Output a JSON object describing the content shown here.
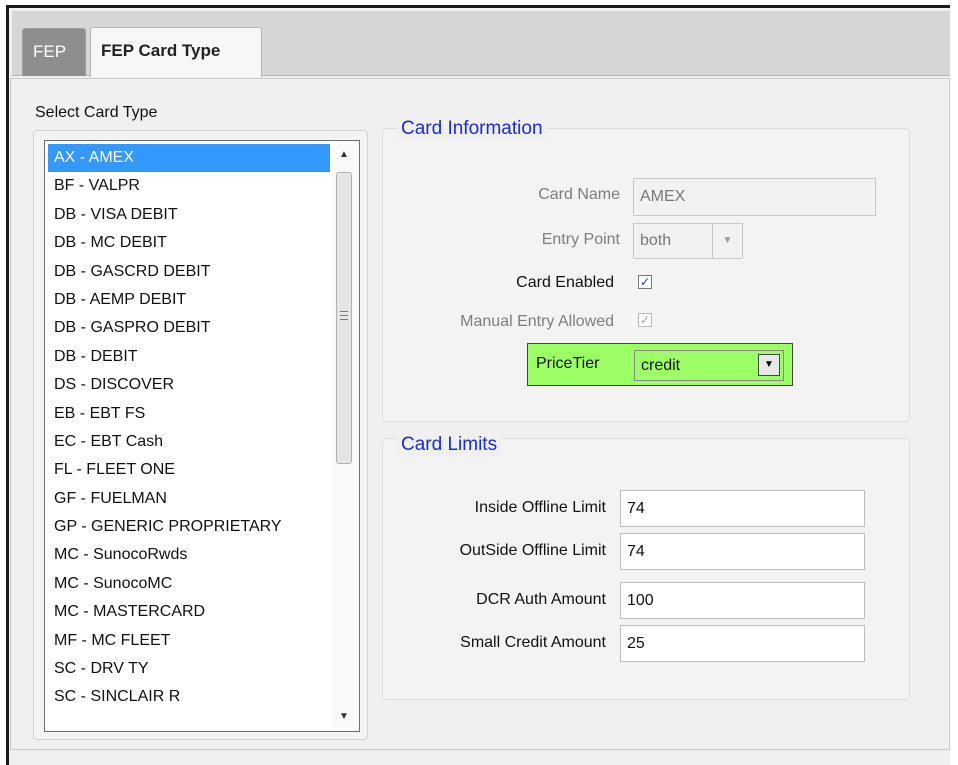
{
  "tabs": [
    {
      "label": "FEP",
      "active": false
    },
    {
      "label": "FEP Card Type",
      "active": true
    }
  ],
  "card_list": {
    "label": "Select Card Type",
    "selected_index": 0,
    "items": [
      "AX - AMEX",
      "BF - VALPR",
      "DB - VISA DEBIT",
      "DB - MC DEBIT",
      "DB - GASCRD DEBIT",
      "DB - AEMP DEBIT",
      "DB - GASPRO DEBIT",
      "DB - DEBIT",
      "DS - DISCOVER",
      "EB - EBT FS",
      "EC - EBT Cash",
      "FL - FLEET ONE",
      "GF - FUELMAN",
      "GP - GENERIC PROPRIETARY",
      "MC - SunocoRwds",
      "MC - SunocoMC",
      "MC - MASTERCARD",
      "MF - MC FLEET",
      "SC - DRV TY",
      "SC - SINCLAIR R"
    ]
  },
  "card_info": {
    "title": "Card Information",
    "card_name_label": "Card Name",
    "card_name_value": "AMEX",
    "entry_point_label": "Entry Point",
    "entry_point_value": "both",
    "card_enabled_label": "Card Enabled",
    "card_enabled": true,
    "manual_entry_label": "Manual Entry Allowed",
    "manual_entry": true,
    "price_tier_label": "PriceTier",
    "price_tier_value": "credit",
    "price_tier_highlight": "#9dff66"
  },
  "card_limits": {
    "title": "Card Limits",
    "fields": [
      {
        "label": "Inside Offline Limit",
        "value": "74"
      },
      {
        "label": "OutSide Offline Limit",
        "value": "74"
      },
      {
        "label": "DCR Auth Amount",
        "value": "100"
      },
      {
        "label": "Small Credit Amount",
        "value": "25"
      }
    ]
  },
  "colors": {
    "section_title": "#1d2bd6",
    "selection": "#3399ff"
  }
}
